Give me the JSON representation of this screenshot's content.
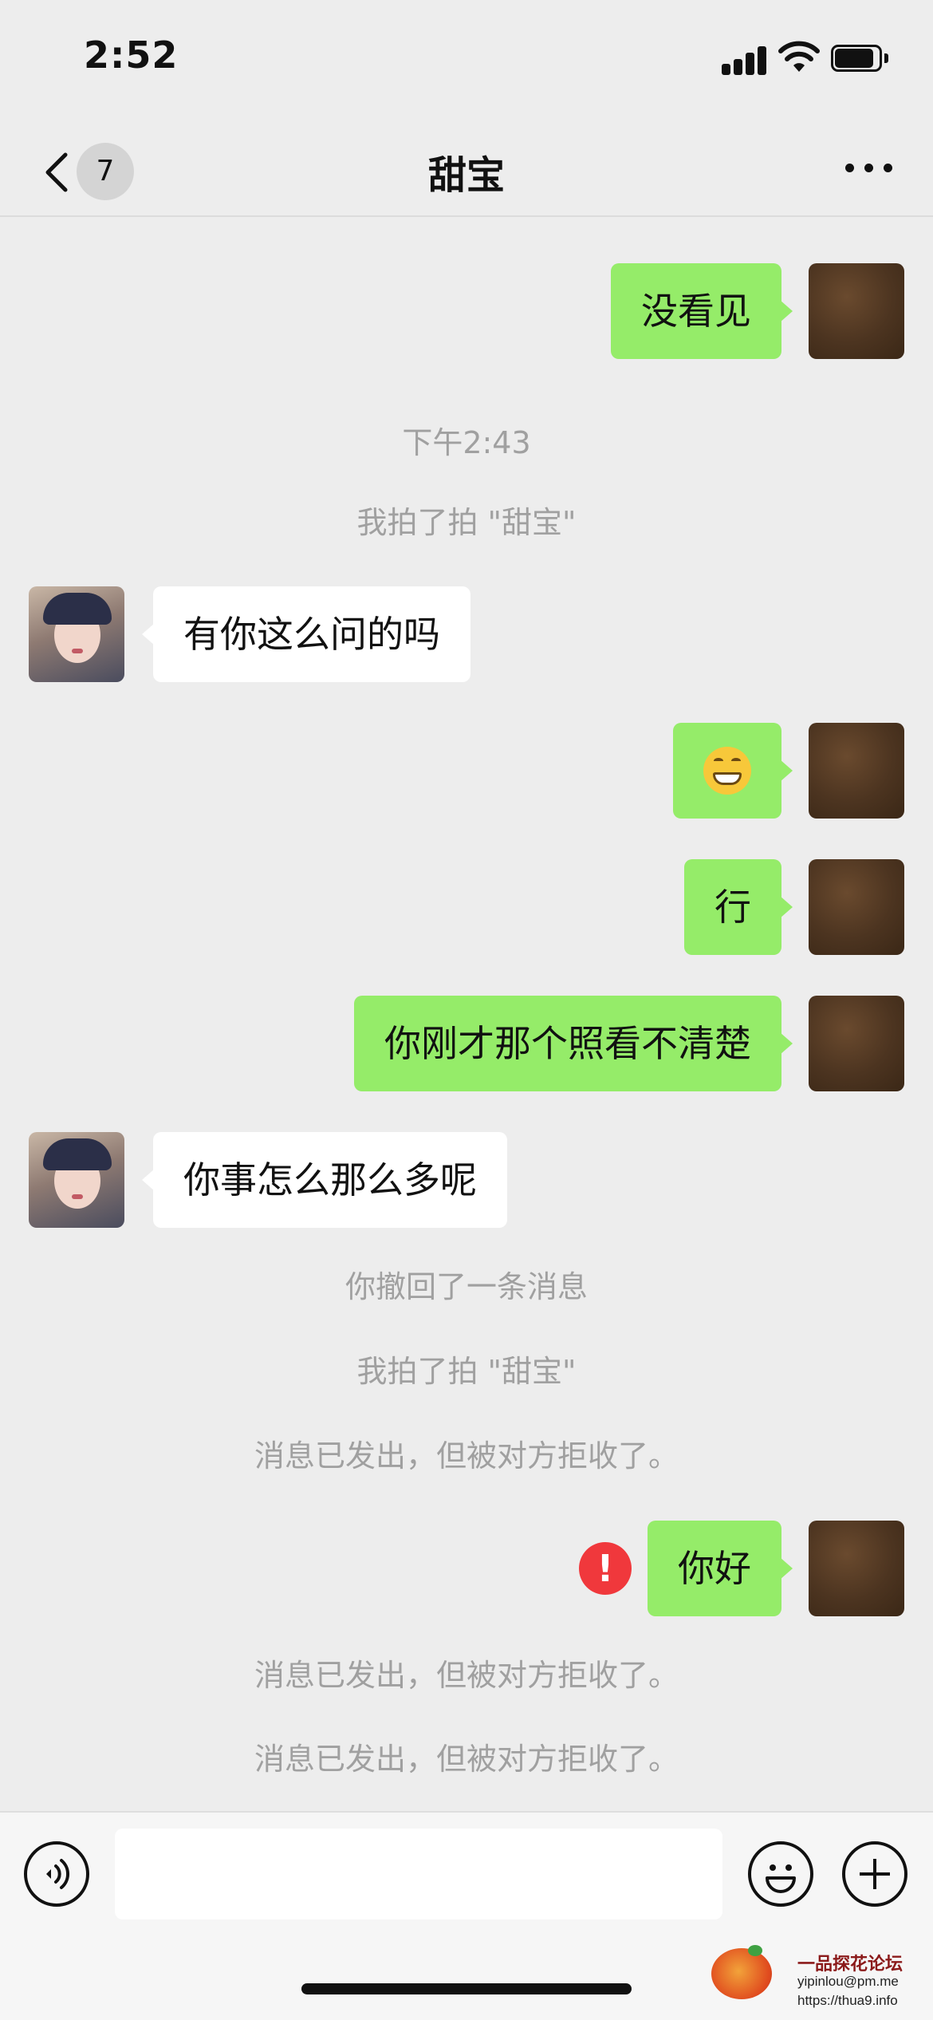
{
  "status_bar": {
    "time": "2:52"
  },
  "nav": {
    "unread_count": "7",
    "title": "甜宝"
  },
  "messages": {
    "m1": "没看见",
    "t1": "下午2:43",
    "s1": "我拍了拍 \"甜宝\"",
    "m2": "有你这么问的吗",
    "m3_emoji": "grinning-face-emoji",
    "m4": "行",
    "m5": "你刚才那个照看不清楚",
    "m6": "你事怎么那么多呢",
    "s2": "你撤回了一条消息",
    "s3": "我拍了拍 \"甜宝\"",
    "s4": "消息已发出，但被对方拒收了。",
    "m7": "你好",
    "m7_fail_mark": "!",
    "s5": "消息已发出，但被对方拒收了。",
    "s6": "消息已发出，但被对方拒收了。"
  },
  "input": {
    "placeholder": ""
  },
  "watermark": {
    "title": "一品探花论坛",
    "email": "yipinlou@pm.me",
    "url": "https://thua9.info"
  },
  "colors": {
    "outgoing_bubble": "#95ec69",
    "incoming_bubble": "#ffffff",
    "background": "#ededed",
    "system_text": "#a0a0a0",
    "error": "#f0383c"
  }
}
